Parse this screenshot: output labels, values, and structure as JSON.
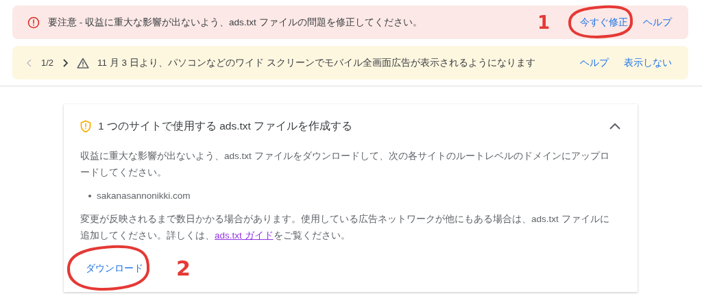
{
  "alerts": [
    {
      "kind": "error",
      "message": "要注意 - 収益に重大な影響が出ないよう、ads.txt ファイルの問題を修正してください。",
      "actions": [
        {
          "label": "今すぐ修正",
          "annotation": "1"
        },
        {
          "label": "ヘルプ"
        }
      ]
    },
    {
      "kind": "warning",
      "pager": "1/2",
      "message": "11 月 3 日より、パソコンなどのワイド スクリーンでモバイル全画面広告が表示されるようになります",
      "actions": [
        {
          "label": "ヘルプ"
        },
        {
          "label": "表示しない"
        }
      ]
    }
  ],
  "card": {
    "title": "1 つのサイトで使用する ads.txt ファイルを作成する",
    "expanded": true,
    "intro": "収益に重大な影響が出ないよう、ads.txt ファイルをダウンロードして、次の各サイトのルートレベルのドメインにアップロードしてください。",
    "sites": [
      "sakanasannonikki.com"
    ],
    "note": {
      "before": "変更が反映されるまで数日かかる場合があります。使用している広告ネットワークが他にもある場合は、ads.txt ファイルに追加してください。詳しくは、",
      "link": "ads.txt ガイド",
      "after": "をご覧ください。"
    },
    "button": {
      "label": "ダウンロード",
      "annotation": "2"
    }
  }
}
